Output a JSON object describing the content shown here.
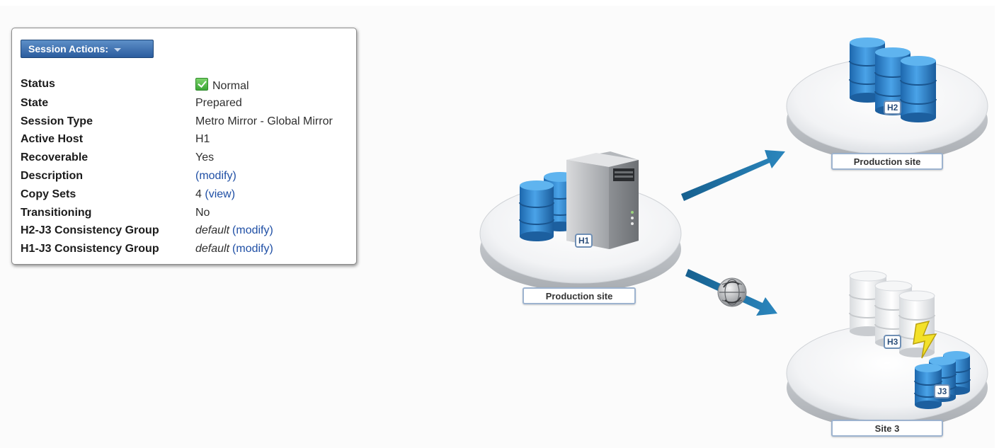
{
  "panel": {
    "actions_label": "Session Actions:",
    "status": {
      "label": "Status",
      "value": "Normal",
      "icon": "green-check-icon"
    },
    "rows": [
      {
        "label": "State",
        "value": "Prepared"
      },
      {
        "label": "Session Type",
        "value": "Metro Mirror - Global Mirror"
      },
      {
        "label": "Active Host",
        "value": "H1"
      },
      {
        "label": "Recoverable",
        "value": "Yes"
      }
    ],
    "description": {
      "label": "Description",
      "link": "(modify)"
    },
    "copy_sets": {
      "label": "Copy Sets",
      "count": "4",
      "link": "(view)"
    },
    "transitioning": {
      "label": "Transitioning",
      "value": "No"
    },
    "groups": [
      {
        "label": "H2-J3 Consistency Group",
        "value": "default",
        "link": "(modify)"
      },
      {
        "label": "H1-J3 Consistency Group",
        "value": "default",
        "link": "(modify)"
      }
    ]
  },
  "topology": {
    "sites": [
      {
        "id": "h1",
        "label": "Production site",
        "tag": "H1"
      },
      {
        "id": "h2",
        "label": "Production site",
        "tag": "H2"
      },
      {
        "id": "site3",
        "label": "Site 3",
        "tags": [
          "H3",
          "J3"
        ]
      }
    ],
    "colors": {
      "volume_blue": "#2b7fc7",
      "arrow_teal": "#1e6fa3",
      "label_border": "#9db3cf"
    }
  }
}
